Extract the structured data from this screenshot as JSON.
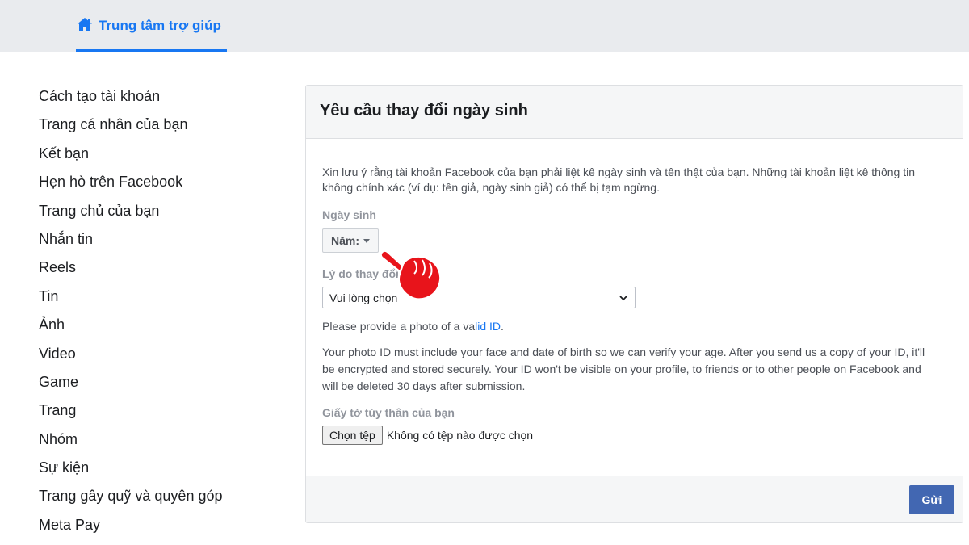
{
  "header": {
    "home_label": "Trung tâm trợ giúp",
    "accent_color": "#1877f2",
    "icon": "home-icon"
  },
  "sidebar": {
    "items": [
      {
        "label": "Cách tạo tài khoản"
      },
      {
        "label": "Trang cá nhân của bạn"
      },
      {
        "label": "Kết bạn"
      },
      {
        "label": "Hẹn hò trên Facebook"
      },
      {
        "label": "Trang chủ của bạn"
      },
      {
        "label": "Nhắn tin"
      },
      {
        "label": "Reels"
      },
      {
        "label": "Tin"
      },
      {
        "label": "Ảnh"
      },
      {
        "label": "Video"
      },
      {
        "label": "Game"
      },
      {
        "label": "Trang"
      },
      {
        "label": "Nhóm"
      },
      {
        "label": "Sự kiện"
      },
      {
        "label": "Trang gây quỹ và quyên góp"
      },
      {
        "label": "Meta Pay"
      }
    ]
  },
  "form": {
    "title": "Yêu cầu thay đổi ngày sinh",
    "notice": "Xin lưu ý rằng tài khoản Facebook của bạn phải liệt kê ngày sinh và tên thật của bạn. Những tài khoản liệt kê thông tin không chính xác (ví dụ: tên giả, ngày sinh giả) có thể bị tạm ngừng.",
    "birthday_label": "Ngày sinh",
    "year_button": "Năm:",
    "reason_label": "Lý do thay đổi",
    "reason_select": "Vui lòng chọn",
    "id_prompt_before": "Please provide a photo of a va",
    "id_prompt_link": "lid ID",
    "id_prompt_after": ".",
    "id_info": "Your photo ID must include your face and date of birth so we can verify your age. After you send us a copy of your ID, it'll be encrypted and stored securely. Your ID won't be visible on your profile, to friends or to other people on Facebook and will be deleted 30 days after submission.",
    "id_doc_label": "Giấy tờ tùy thân của bạn",
    "file_button": "Chọn tệp",
    "file_status": "Không có tệp nào được chọn",
    "submit_label": "Gửi",
    "submit_color": "#4267b2"
  },
  "overlay": {
    "icon": "pointing-hand-icon",
    "color": "#e8141b"
  }
}
